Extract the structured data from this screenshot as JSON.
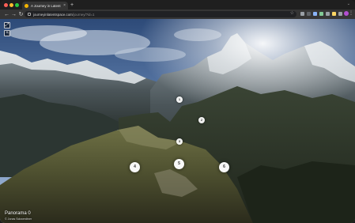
{
  "browser": {
    "tab_title": "A Journey in Latent Space",
    "tab_close": "×",
    "new_tab": "+",
    "url_host": "journeyinlatentspace.com",
    "url_path": "/journey/?id=1",
    "back": "←",
    "forward": "→",
    "reload": "↻",
    "menu": "⋮",
    "tab_menu": "⌄",
    "star": "☆"
  },
  "viewer": {
    "fullscreen_btn": "⤢",
    "zoom_btn": "+",
    "hotspots": [
      {
        "label": "1"
      },
      {
        "label": "2"
      },
      {
        "label": "3"
      },
      {
        "label": "4"
      },
      {
        "label": "5"
      },
      {
        "label": "6"
      }
    ],
    "panorama_title": "Panorama 0",
    "credit": "© Jonas Sckwerdtner"
  },
  "colors": {
    "sky_top": "#2d4a78",
    "sky_mid": "#8aa6cf",
    "mountain_dark": "#2f3a36",
    "forest": "#3e4630",
    "snow": "#e6ebef"
  }
}
